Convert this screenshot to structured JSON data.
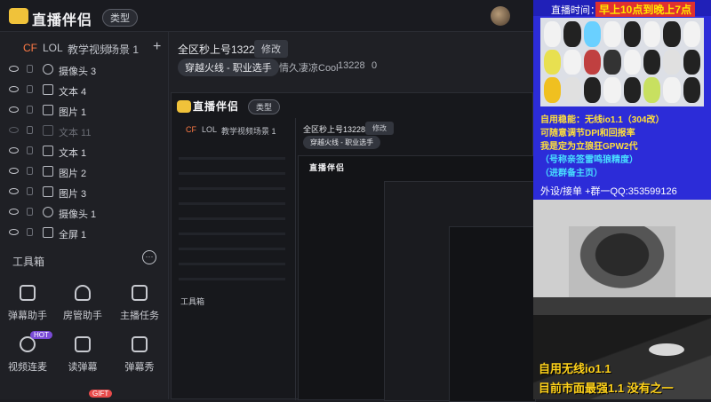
{
  "app": {
    "logo_text": "直播伴侣",
    "type_button": "类型"
  },
  "sidebar": {
    "tabs": [
      "CF",
      "LOL",
      "教学视频",
      "场景 1"
    ],
    "add": "+",
    "sources": [
      {
        "label": "摄像头 3",
        "icon": "camera",
        "visible": true
      },
      {
        "label": "文本 4",
        "icon": "text",
        "visible": true
      },
      {
        "label": "图片 1",
        "icon": "image",
        "visible": true
      },
      {
        "label": "文本 11",
        "icon": "text",
        "visible": false
      },
      {
        "label": "文本 1",
        "icon": "text",
        "visible": true
      },
      {
        "label": "图片 2",
        "icon": "image",
        "visible": true
      },
      {
        "label": "图片 3",
        "icon": "image",
        "visible": true
      },
      {
        "label": "摄像头 1",
        "icon": "camera",
        "visible": true
      },
      {
        "label": "全屏 1",
        "icon": "fullscreen",
        "visible": true
      }
    ],
    "toolbox_title": "工具箱",
    "more": "···",
    "tools": [
      {
        "label": "弹幕助手",
        "icon": "danmaku-icon"
      },
      {
        "label": "房管助手",
        "icon": "admin-icon"
      },
      {
        "label": "主播任务",
        "icon": "task-icon"
      },
      {
        "label": "视频连麦",
        "icon": "video-link-icon",
        "badge": "HOT"
      },
      {
        "label": "读弹幕",
        "icon": "read-danmaku-icon"
      },
      {
        "label": "弹幕秀",
        "icon": "danmaku-show-icon"
      }
    ],
    "gift_badge": "GIFT"
  },
  "preview": {
    "room_title": "全区秒上号13228",
    "edit_button": "修改",
    "category_tag": "穿越火线 - 职业选手",
    "streamer": "情久凄凉Cool",
    "room_id": "13228",
    "likes": "0"
  },
  "ad": {
    "head_left": "直播时间：",
    "head_right": "早上10点到晚上7点",
    "lines": [
      "自用稳能：无线io1.1（304改）",
      "可随意调节DPI和回报率",
      "我是定为立狼狂GPW2代",
      "（号称亲签雷鸣狼精度）",
      "（进群备主页）"
    ],
    "footer": "外设/接单  +群一QQ:353599126"
  },
  "captions": [
    "自用无线io1.1",
    "目前市面最强1.1 没有之一"
  ],
  "colors": {
    "accent": "#ff7a45",
    "brand_yellow": "#f0c23a",
    "ad_blue": "#2c2cd8",
    "caption": "#ffd21a"
  }
}
